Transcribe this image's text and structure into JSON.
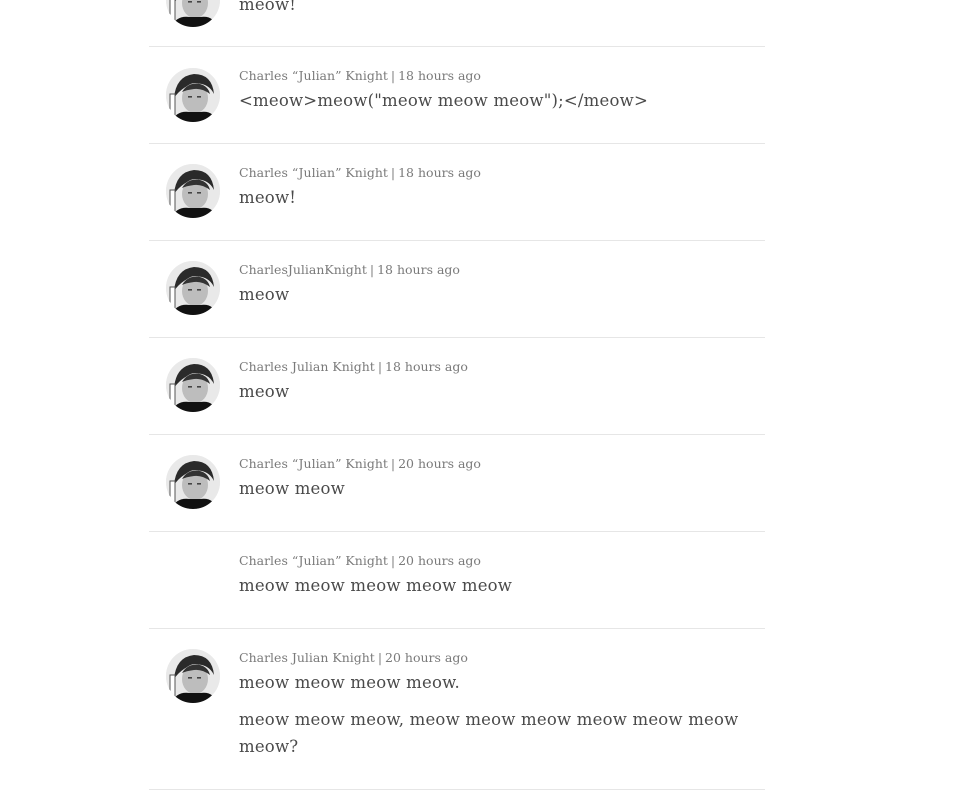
{
  "posts": [
    {
      "author": "",
      "time": "",
      "lines": [
        "meow!"
      ],
      "avatar": true
    },
    {
      "author": "Charles “Julian” Knight",
      "time": "18 hours ago",
      "lines": [
        "<meow>meow(\"meow meow meow\");</meow>"
      ],
      "avatar": true
    },
    {
      "author": "Charles “Julian” Knight",
      "time": "18 hours ago",
      "lines": [
        "meow!"
      ],
      "avatar": true
    },
    {
      "author": "CharlesJulianKnight",
      "time": "18 hours ago",
      "lines": [
        "meow"
      ],
      "avatar": true
    },
    {
      "author": "Charles Julian Knight",
      "time": "18 hours ago",
      "lines": [
        "meow"
      ],
      "avatar": true
    },
    {
      "author": "Charles “Julian” Knight",
      "time": "20 hours ago",
      "lines": [
        "meow meow"
      ],
      "avatar": true
    },
    {
      "author": "Charles “Julian” Knight",
      "time": "20 hours ago",
      "lines": [
        "meow meow meow meow meow"
      ],
      "avatar": false
    },
    {
      "author": "Charles Julian Knight",
      "time": "20 hours ago",
      "lines": [
        "meow meow meow meow.",
        "meow meow meow, meow meow meow meow meow meow meow?"
      ],
      "avatar": true
    }
  ],
  "separator": "|"
}
